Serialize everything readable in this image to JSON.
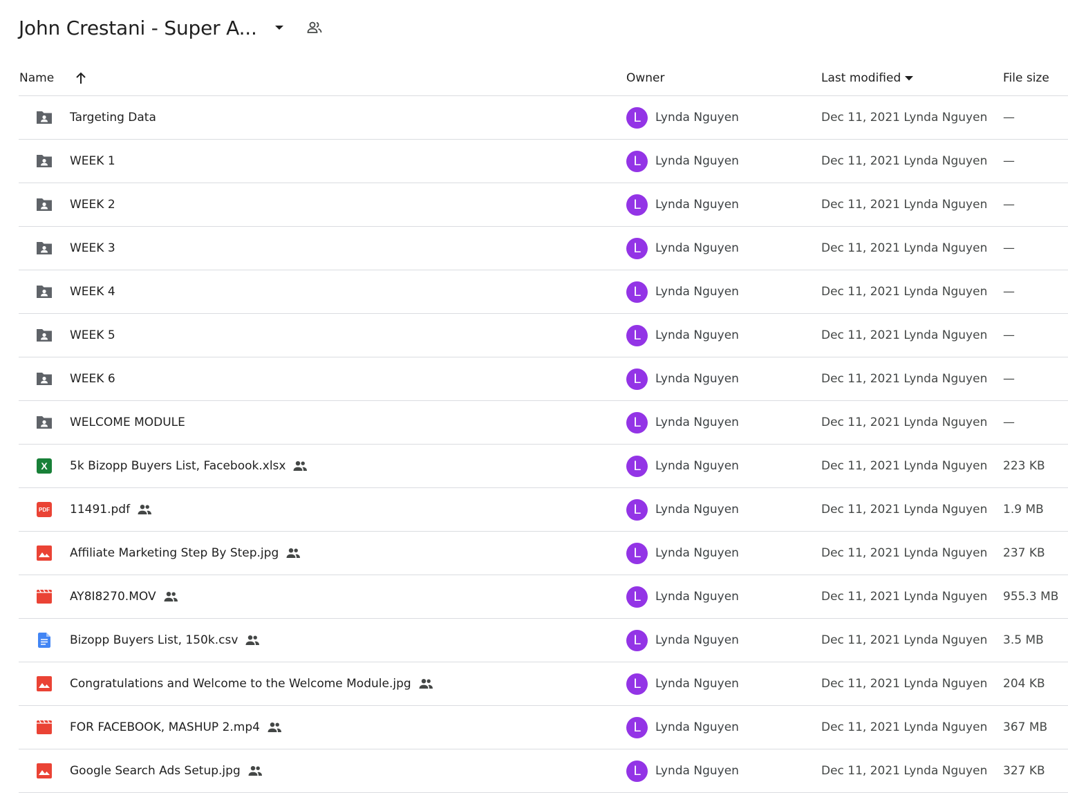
{
  "header": {
    "folder_title": "John Crestani - Super A..."
  },
  "columns": {
    "name": "Name",
    "owner": "Owner",
    "last_modified": "Last modified",
    "file_size": "File size"
  },
  "colors": {
    "avatar": "#9334e6",
    "folder_icon": "#5f6368",
    "xlsx_icon": "#188038",
    "pdf_icon": "#ea4335",
    "image_icon": "#ea4335",
    "video_icon": "#ea4335",
    "doc_icon": "#4285f4"
  },
  "files": [
    {
      "name": "Targeting Data",
      "type": "folder",
      "icon": "shared-folder-icon",
      "shared": false,
      "owner_initial": "L",
      "owner": "Lynda Nguyen",
      "modified": "Dec 11, 2021 Lynda Nguyen",
      "size": "—"
    },
    {
      "name": "WEEK 1",
      "type": "folder",
      "icon": "shared-folder-icon",
      "shared": false,
      "owner_initial": "L",
      "owner": "Lynda Nguyen",
      "modified": "Dec 11, 2021 Lynda Nguyen",
      "size": "—"
    },
    {
      "name": "WEEK 2",
      "type": "folder",
      "icon": "shared-folder-icon",
      "shared": false,
      "owner_initial": "L",
      "owner": "Lynda Nguyen",
      "modified": "Dec 11, 2021 Lynda Nguyen",
      "size": "—"
    },
    {
      "name": "WEEK 3",
      "type": "folder",
      "icon": "shared-folder-icon",
      "shared": false,
      "owner_initial": "L",
      "owner": "Lynda Nguyen",
      "modified": "Dec 11, 2021 Lynda Nguyen",
      "size": "—"
    },
    {
      "name": "WEEK 4",
      "type": "folder",
      "icon": "shared-folder-icon",
      "shared": false,
      "owner_initial": "L",
      "owner": "Lynda Nguyen",
      "modified": "Dec 11, 2021 Lynda Nguyen",
      "size": "—"
    },
    {
      "name": "WEEK 5",
      "type": "folder",
      "icon": "shared-folder-icon",
      "shared": false,
      "owner_initial": "L",
      "owner": "Lynda Nguyen",
      "modified": "Dec 11, 2021 Lynda Nguyen",
      "size": "—"
    },
    {
      "name": "WEEK 6",
      "type": "folder",
      "icon": "shared-folder-icon",
      "shared": false,
      "owner_initial": "L",
      "owner": "Lynda Nguyen",
      "modified": "Dec 11, 2021 Lynda Nguyen",
      "size": "—"
    },
    {
      "name": "WELCOME MODULE",
      "type": "folder",
      "icon": "shared-folder-icon",
      "shared": false,
      "owner_initial": "L",
      "owner": "Lynda Nguyen",
      "modified": "Dec 11, 2021 Lynda Nguyen",
      "size": "—"
    },
    {
      "name": "5k Bizopp Buyers List, Facebook.xlsx",
      "type": "xlsx",
      "icon": "spreadsheet-icon",
      "shared": true,
      "owner_initial": "L",
      "owner": "Lynda Nguyen",
      "modified": "Dec 11, 2021 Lynda Nguyen",
      "size": "223 KB"
    },
    {
      "name": "11491.pdf",
      "type": "pdf",
      "icon": "pdf-icon",
      "shared": true,
      "owner_initial": "L",
      "owner": "Lynda Nguyen",
      "modified": "Dec 11, 2021 Lynda Nguyen",
      "size": "1.9 MB"
    },
    {
      "name": "Affiliate Marketing Step By Step.jpg",
      "type": "image",
      "icon": "image-icon",
      "shared": true,
      "owner_initial": "L",
      "owner": "Lynda Nguyen",
      "modified": "Dec 11, 2021 Lynda Nguyen",
      "size": "237 KB"
    },
    {
      "name": "AY8I8270.MOV",
      "type": "video",
      "icon": "video-icon",
      "shared": true,
      "owner_initial": "L",
      "owner": "Lynda Nguyen",
      "modified": "Dec 11, 2021 Lynda Nguyen",
      "size": "955.3 MB"
    },
    {
      "name": "Bizopp Buyers List, 150k.csv",
      "type": "doc",
      "icon": "document-icon",
      "shared": true,
      "owner_initial": "L",
      "owner": "Lynda Nguyen",
      "modified": "Dec 11, 2021 Lynda Nguyen",
      "size": "3.5 MB"
    },
    {
      "name": "Congratulations and Welcome to the Welcome Module.jpg",
      "type": "image",
      "icon": "image-icon",
      "shared": true,
      "owner_initial": "L",
      "owner": "Lynda Nguyen",
      "modified": "Dec 11, 2021 Lynda Nguyen",
      "size": "204 KB"
    },
    {
      "name": "FOR FACEBOOK, MASHUP 2.mp4",
      "type": "video",
      "icon": "video-icon",
      "shared": true,
      "owner_initial": "L",
      "owner": "Lynda Nguyen",
      "modified": "Dec 11, 2021 Lynda Nguyen",
      "size": "367 MB"
    },
    {
      "name": "Google Search Ads Setup.jpg",
      "type": "image",
      "icon": "image-icon",
      "shared": true,
      "owner_initial": "L",
      "owner": "Lynda Nguyen",
      "modified": "Dec 11, 2021 Lynda Nguyen",
      "size": "327 KB"
    }
  ]
}
